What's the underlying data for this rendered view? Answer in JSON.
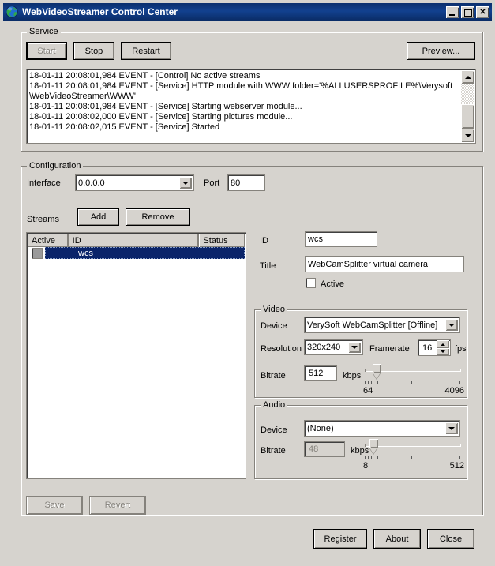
{
  "window": {
    "title": "WebVideoStreamer Control Center",
    "icon": "globe-icon",
    "buttons": {
      "minimize": "minimize-icon",
      "maximize": "maximize-icon",
      "close": "close-icon"
    }
  },
  "service": {
    "legend": "Service",
    "start_label": "Start",
    "start_enabled": false,
    "stop_label": "Stop",
    "restart_label": "Restart",
    "preview_label": "Preview...",
    "log_lines": [
      "18-01-11 20:08:01,984 EVENT - [Control] No active streams",
      "18-01-11 20:08:01,984 EVENT - [Service] HTTP module with WWW folder='%ALLUSERSPROFILE%\\Verysoft\\WebVideoStreamer\\WWW'",
      "18-01-11 20:08:01,984 EVENT - [Service] Starting webserver module...",
      "18-01-11 20:08:02,000 EVENT - [Service] Starting pictures module...",
      "18-01-11 20:08:02,015 EVENT - [Service] Started"
    ]
  },
  "configuration": {
    "legend": "Configuration",
    "interface_label": "Interface",
    "interface_value": "0.0.0.0",
    "port_label": "Port",
    "port_value": "80",
    "streams_label": "Streams",
    "add_label": "Add",
    "remove_label": "Remove",
    "list": {
      "columns": [
        "Active",
        "ID",
        "Status"
      ],
      "rows": [
        {
          "active": false,
          "id": "wcs",
          "status": "",
          "selected": true
        }
      ]
    },
    "save_label": "Save",
    "save_enabled": false,
    "revert_label": "Revert",
    "revert_enabled": false
  },
  "stream": {
    "id_label": "ID",
    "id_value": "wcs",
    "title_label": "Title",
    "title_value": "WebCamSplitter virtual camera",
    "active_label": "Active",
    "active_checked": false,
    "video": {
      "legend": "Video",
      "device_label": "Device",
      "device_value": "VerySoft WebCamSplitter [Offline]",
      "resolution_label": "Resolution",
      "resolution_value": "320x240",
      "framerate_label": "Framerate",
      "framerate_value": "16",
      "fps_label": "fps",
      "bitrate_label": "Bitrate",
      "bitrate_value": "512",
      "kbps_label": "kbps",
      "bitrate_min": "64",
      "bitrate_max": "4096"
    },
    "audio": {
      "legend": "Audio",
      "device_label": "Device",
      "device_value": "(None)",
      "bitrate_label": "Bitrate",
      "bitrate_value": "48",
      "bitrate_enabled": false,
      "kbps_label": "kbps",
      "bitrate_min": "8",
      "bitrate_max": "512"
    }
  },
  "footer": {
    "register_label": "Register",
    "about_label": "About",
    "close_label": "Close"
  },
  "colors": {
    "titlebar": "#0b2f6e",
    "face": "#d6d3ce",
    "selection": "#0a246a",
    "field": "#ffffff",
    "disabled_text": "#85827c"
  }
}
